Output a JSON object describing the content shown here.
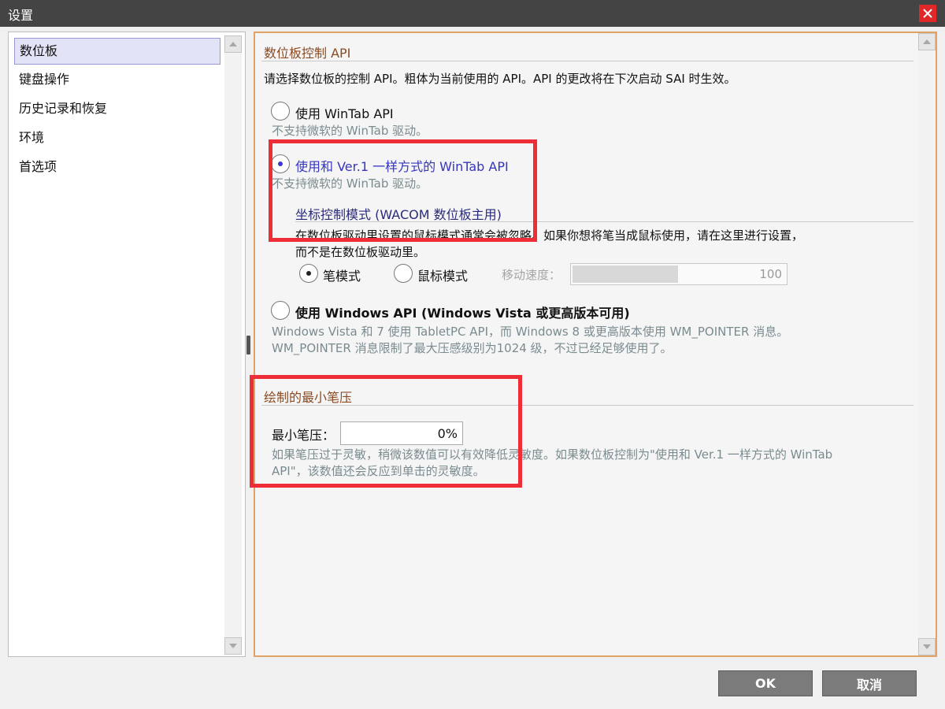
{
  "window": {
    "title": "设置",
    "close_icon": "close-icon"
  },
  "sidebar": {
    "items": [
      {
        "label": "数位板",
        "selected": true
      },
      {
        "label": "键盘操作"
      },
      {
        "label": "历史记录和恢复"
      },
      {
        "label": "环境"
      },
      {
        "label": "首选项"
      }
    ]
  },
  "tablet_api": {
    "title": "数位板控制 API",
    "description": "请选择数位板的控制 API。粗体为当前使用的 API。API 的更改将在下次启动 SAI 时生效。",
    "option_wintab": {
      "label": "使用 WinTab API",
      "note": "不支持微软的 WinTab 驱动。",
      "checked": false
    },
    "option_ver1": {
      "label": "使用和 Ver.1 一样方式的 WinTab API",
      "note": "不支持微软的 WinTab 驱动。",
      "checked": true
    },
    "coordinate_mode": {
      "title": "坐标控制模式 (WACOM 数位板主用)",
      "desc_line1": "在数位板驱动里设置的鼠标模式通常会被忽略。如果你想将笔当成鼠标使用，请在这里进行设置，",
      "desc_line2": "而不是在数位板驱动里。",
      "pen_mode": "笔模式",
      "mouse_mode": "鼠标模式",
      "speed_label": "移动速度：",
      "speed_value": "100",
      "selected": "pen"
    },
    "option_windows": {
      "label": "使用 Windows API (Windows Vista 或更高版本可用)",
      "note_line1": "Windows Vista 和 7 使用 TabletPC API，而 Windows 8 或更高版本使用 WM_POINTER 消息。",
      "note_line2": "WM_POINTER 消息限制了最大压感级别为1024 级，不过已经足够使用了。",
      "checked": false
    }
  },
  "min_pressure": {
    "title": "绘制的最小笔压",
    "label": "最小笔压：",
    "value": "0%",
    "note_line1": "如果笔压过于灵敏，稍微该数值可以有效降低灵敏度。如果数位板控制为\"使用和 Ver.1 一样方式的 WinTab",
    "note_line2": "API\"，该数值还会反应到单击的灵敏度。"
  },
  "buttons": {
    "ok": "OK",
    "cancel": "取消"
  },
  "colors": {
    "titlebar": "#444444",
    "close": "#e12828",
    "highlight": "#ef2d36",
    "panel_border": "#e2a266",
    "section_title": "#8a4a22",
    "selected_option": "#3535c0",
    "note_text": "#7a8b90",
    "button": "#7b7b7b"
  }
}
